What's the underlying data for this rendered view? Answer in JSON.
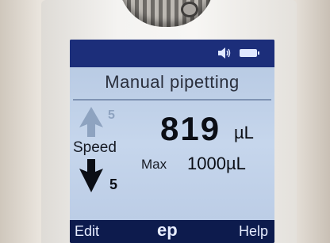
{
  "screen": {
    "title": "Manual pipetting",
    "volume": {
      "value": "819",
      "unit": "µL"
    },
    "max": {
      "label": "Max",
      "value": "1000µL"
    },
    "speed": {
      "label": "Speed",
      "aspirate": "5",
      "dispense": "5"
    }
  },
  "status": {
    "sound_icon": "speaker-icon",
    "battery_icon": "battery-icon"
  },
  "softkeys": {
    "left": "Edit",
    "center": "ep",
    "right": "Help"
  },
  "colors": {
    "screen_bg": "#b9cbe4",
    "bezel": "#0d1b4d",
    "header": "#1c2e7a"
  }
}
